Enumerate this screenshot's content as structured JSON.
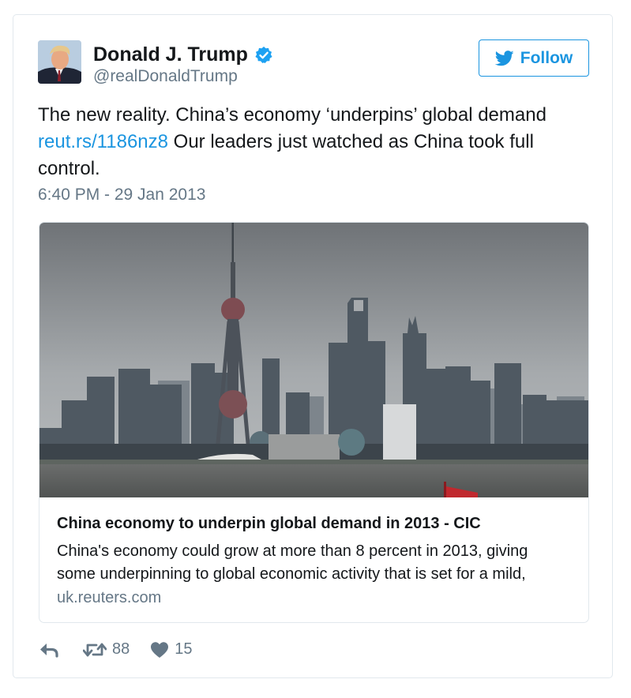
{
  "colors": {
    "link": "#1b95e0",
    "verified": "#1da1f2",
    "secondary_text": "#657786",
    "border": "#e1e8ed"
  },
  "author": {
    "name": "Donald J. Trump",
    "handle": "@realDonaldTrump",
    "verified": true,
    "avatar_icon": "profile-photo"
  },
  "follow_button": {
    "label": "Follow",
    "icon": "twitter-bird-icon"
  },
  "tweet": {
    "text_part1": "The new reality. China’s economy ‘underpins’ global demand ",
    "link_text": "reut.rs/1186nz8",
    "text_part2": " Our leaders just watched as China took full control.",
    "timestamp": "6:40 PM - 29 Jan 2013"
  },
  "card": {
    "image_subject": "city-skyline-photo",
    "title": "China economy to underpin global demand in 2013 - CIC",
    "description": "China's economy could grow at more than 8 percent in 2013, giving some underpinning to global economic activity that is set for a mild,",
    "domain": "uk.reuters.com"
  },
  "actions": {
    "reply_icon": "reply-icon",
    "retweet_icon": "retweet-icon",
    "retweet_count": "88",
    "like_icon": "heart-icon",
    "like_count": "15"
  }
}
